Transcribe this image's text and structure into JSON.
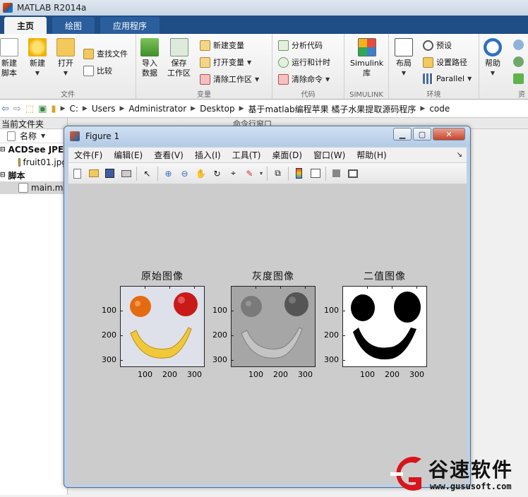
{
  "app": {
    "title": "MATLAB R2014a"
  },
  "tabs": [
    {
      "label": "主页"
    },
    {
      "label": "绘图"
    },
    {
      "label": "应用程序"
    }
  ],
  "ribbon": {
    "groups": [
      "文件",
      "变量",
      "代码",
      "SIMULINK",
      "环境",
      "资"
    ],
    "new_script": "新建\n脚本",
    "new_script_a": "新建",
    "new_script_b": "脚本",
    "new": "新建",
    "open": "打开",
    "find_files": "查找文件",
    "compare": "比较",
    "import_data_a": "导入",
    "import_data_b": "数据",
    "save_ws_a": "保存",
    "save_ws_b": "工作区",
    "new_var": "新建变量",
    "open_var": "打开变量",
    "clear_ws": "清除工作区",
    "analyze_code": "分析代码",
    "run_time": "运行和计时",
    "clear_cmd": "清除命令",
    "simulink_a": "Simulink",
    "simulink_b": "库",
    "layout": "布局",
    "prefs": "预设",
    "set_path": "设置路径",
    "parallel": "Parallel",
    "help": "帮助"
  },
  "address": {
    "segments": [
      "C:",
      "Users",
      "Administrator",
      "Desktop",
      "基于matlab编程苹果 橘子水果提取源码程序",
      "code"
    ]
  },
  "left_panel": {
    "title": "当前文件夹",
    "name_header": "名称",
    "items": [
      {
        "label": "ACDSee JPEG"
      },
      {
        "label": "fruit01.jpg"
      },
      {
        "label": "脚本"
      },
      {
        "label": "main.m"
      }
    ]
  },
  "command_window": {
    "title": "命令行窗口"
  },
  "figure": {
    "title": "Figure 1",
    "menu": [
      "文件(F)",
      "编辑(E)",
      "查看(V)",
      "插入(I)",
      "工具(T)",
      "桌面(D)",
      "窗口(W)",
      "帮助(H)"
    ],
    "plots": [
      {
        "title": "原始图像"
      },
      {
        "title": "灰度图像"
      },
      {
        "title": "二值图像"
      }
    ],
    "xticks": [
      "100",
      "200",
      "300"
    ],
    "yticks": [
      "100",
      "200",
      "300"
    ]
  },
  "watermark": {
    "brand": "谷速软件",
    "url": "www.gususoft.com"
  }
}
